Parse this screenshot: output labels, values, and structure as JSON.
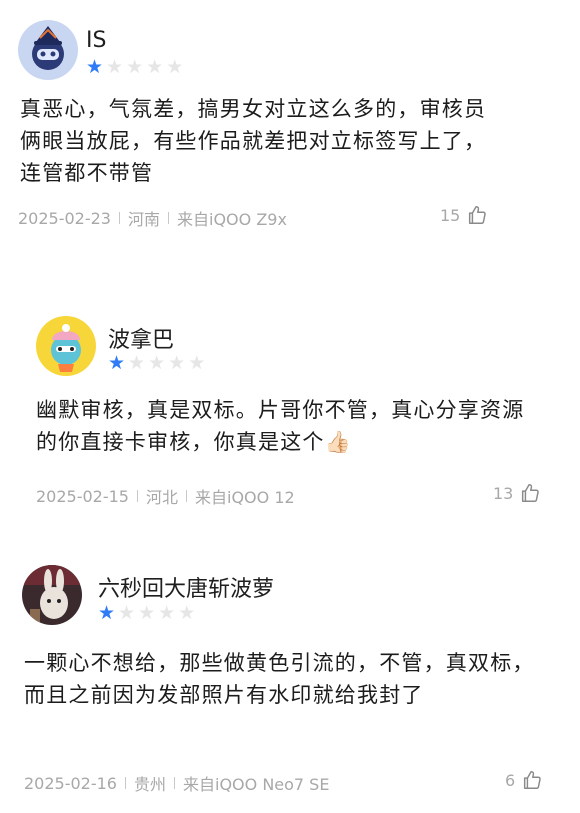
{
  "reviews": [
    {
      "username": "IS",
      "rating": 1,
      "text": "真恶心，气氛差，搞男女对立这么多的，审核员俩眼当放屁，有些作品就差把对立标签写上了，连管都不带管",
      "date": "2025-02-23",
      "region": "河南",
      "device": "来自iQOO Z9x",
      "likes": "15"
    },
    {
      "username": "波拿巴",
      "rating": 1,
      "text": "幽默审核，真是双标。片哥你不管，真心分享资源的你直接卡审核，你真是这个👍🏻",
      "date": "2025-02-15",
      "region": "河北",
      "device": "来自iQOO 12",
      "likes": "13"
    },
    {
      "username": "六秒回大唐斩波萝",
      "rating": 1,
      "text": "一颗心不想给，那些做黄色引流的，不管，真双标，而且之前因为发部照片有水印就给我封了",
      "date": "2025-02-16",
      "region": "贵州",
      "device": "来自iQOO Neo7 SE",
      "likes": "6"
    }
  ],
  "colors": {
    "star_on": "#2f7cf6",
    "star_off": "#e6e6e6",
    "meta": "#a8a8a8"
  },
  "icons": {
    "like": "thumbs-up-icon",
    "star": "star-icon"
  }
}
